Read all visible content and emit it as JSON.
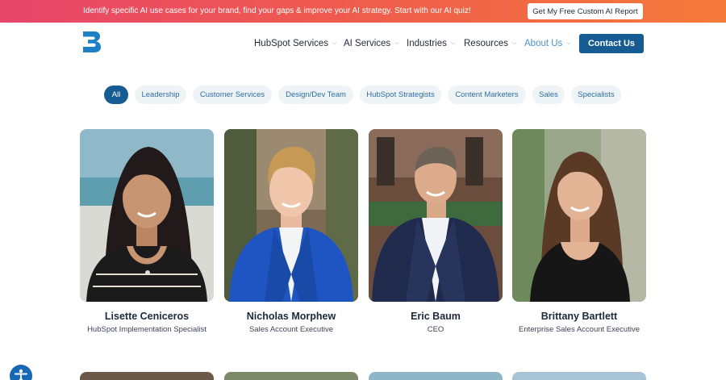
{
  "promo": {
    "text": "Identify specific AI use cases for your brand, find your gaps & improve your AI strategy. Start with our AI quiz!",
    "button": "Get My Free Custom AI Report"
  },
  "nav": {
    "items": [
      {
        "label": "HubSpot Services",
        "has_dropdown": true
      },
      {
        "label": "AI Services",
        "has_dropdown": true
      },
      {
        "label": "Industries",
        "has_dropdown": true
      },
      {
        "label": "Resources",
        "has_dropdown": true
      },
      {
        "label": "About Us",
        "has_dropdown": true,
        "active": true
      }
    ],
    "cta": "Contact Us"
  },
  "filters": [
    {
      "label": "All",
      "active": true
    },
    {
      "label": "Leadership"
    },
    {
      "label": "Customer Services"
    },
    {
      "label": "Design/Dev Team"
    },
    {
      "label": "HubSpot Strategists"
    },
    {
      "label": "Content Marketers"
    },
    {
      "label": "Sales"
    },
    {
      "label": "Specialists"
    }
  ],
  "team": [
    {
      "name": "Lisette Ceniceros",
      "role": "HubSpot Implementation Specialist"
    },
    {
      "name": "Nicholas Morphew",
      "role": "Sales Account Executive"
    },
    {
      "name": "Eric Baum",
      "role": "CEO"
    },
    {
      "name": "Brittany Bartlett",
      "role": "Enterprise Sales Account Executive"
    }
  ],
  "colors": {
    "brand": "#175b93",
    "accent_link": "#4a8fc9",
    "promo_gradient_start": "#e8456b",
    "promo_gradient_end": "#f47a3a",
    "pill_bg": "#eef3f6"
  },
  "icons": {
    "logo": "brand-b-logo",
    "dropdown": "chevron-down-icon",
    "accessibility": "accessibility-icon"
  }
}
